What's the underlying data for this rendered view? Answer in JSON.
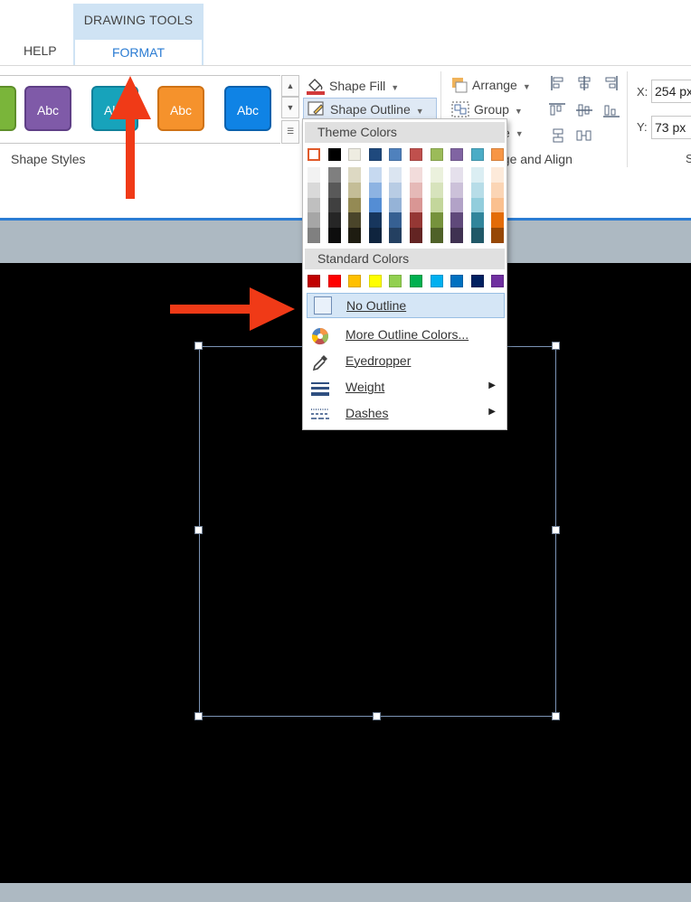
{
  "tabs": {
    "context_group_label": "DRAWING TOOLS",
    "help": "HELP",
    "format": "FORMAT"
  },
  "ribbon": {
    "style_buttons": [
      "Abc",
      "Abc",
      "Abc",
      "Abc"
    ],
    "shape_styles_label": "Shape Styles",
    "shape_fill": "Shape Fill",
    "shape_outline": "Shape Outline",
    "arrange": "Arrange",
    "group": "Group",
    "arrange_group_label": "nge and Align",
    "x_label": "X:",
    "x_value": "254 px",
    "y_label": "Y:",
    "y_value": "73 px"
  },
  "dropdown": {
    "theme_colors_header": "Theme Colors",
    "standard_colors_header": "Standard Colors",
    "theme_base": [
      "#ffffff",
      "#000000",
      "#eeece1",
      "#1f497d",
      "#4f81bd",
      "#c0504d",
      "#9bbb59",
      "#8064a2",
      "#4bacc6",
      "#f79646"
    ],
    "theme_tints": [
      [
        "#f2f2f2",
        "#d9d9d9",
        "#bfbfbf",
        "#a6a6a6",
        "#808080"
      ],
      [
        "#7f7f7f",
        "#595959",
        "#404040",
        "#262626",
        "#0d0d0d"
      ],
      [
        "#ddd9c3",
        "#c4bd97",
        "#948a54",
        "#4a452a",
        "#1e1c11"
      ],
      [
        "#c6d9f0",
        "#8db3e2",
        "#548dd4",
        "#17365d",
        "#0f243e"
      ],
      [
        "#dbe5f1",
        "#b8cce4",
        "#95b3d7",
        "#366092",
        "#244061"
      ],
      [
        "#f2dcdb",
        "#e5b9b7",
        "#d99694",
        "#953734",
        "#632423"
      ],
      [
        "#ebf1dd",
        "#d7e3bc",
        "#c3d69b",
        "#76923c",
        "#4f6128"
      ],
      [
        "#e5e0ec",
        "#ccc1d9",
        "#b2a2c7",
        "#5f497a",
        "#3f3151"
      ],
      [
        "#dbeef3",
        "#b7dde8",
        "#92cddc",
        "#31859b",
        "#205867"
      ],
      [
        "#fdeada",
        "#fbd5b5",
        "#fac08f",
        "#e36c09",
        "#974806"
      ]
    ],
    "standard_colors": [
      "#c00000",
      "#ff0000",
      "#ffc000",
      "#ffff00",
      "#92d050",
      "#00b050",
      "#00b0f0",
      "#0070c0",
      "#002060",
      "#7030a0"
    ],
    "no_outline": "No Outline",
    "more_outline_colors": "More Outline Colors...",
    "eyedropper": "Eyedropper",
    "weight": "Weight",
    "dashes": "Dashes"
  },
  "colors": {
    "accent": "#2b7cd3",
    "annotation_arrow": "#f03a17",
    "canvas": "#000000"
  },
  "icons": [
    "shape-fill-icon",
    "shape-outline-icon",
    "arrange-icon",
    "group-icon",
    "more-colors-icon",
    "eyedropper-icon",
    "weight-icon",
    "dashes-icon",
    "submenu-arrow-icon"
  ]
}
